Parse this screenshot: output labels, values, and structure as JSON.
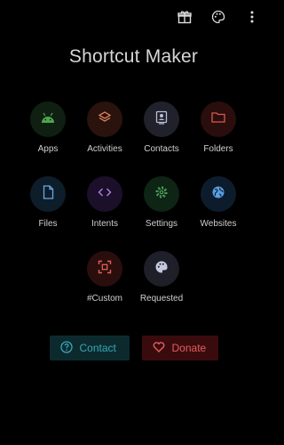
{
  "header": {
    "title": "Shortcut Maker",
    "icons": [
      "gift-icon",
      "palette-icon",
      "more-vert-icon"
    ]
  },
  "tiles": [
    {
      "label": "Apps",
      "icon": "android-icon",
      "bg": "#0f2012",
      "fg": "#4ea54f"
    },
    {
      "label": "Activities",
      "icon": "layers-icon",
      "bg": "#2a120d",
      "fg": "#e3875e"
    },
    {
      "label": "Contacts",
      "icon": "contact-icon",
      "bg": "#20212b",
      "fg": "#b9bdd8"
    },
    {
      "label": "Folders",
      "icon": "folder-icon",
      "bg": "#2a0d0d",
      "fg": "#d85a50"
    },
    {
      "label": "Files",
      "icon": "file-icon",
      "bg": "#0d1d2a",
      "fg": "#6aa8e8"
    },
    {
      "label": "Intents",
      "icon": "code-icon",
      "bg": "#1c0f2a",
      "fg": "#b07ee8"
    },
    {
      "label": "Settings",
      "icon": "gear-icon",
      "bg": "#0e2414",
      "fg": "#4fa45a"
    },
    {
      "label": "Websites",
      "icon": "globe-icon",
      "bg": "#0c1c2c",
      "fg": "#5a9de0"
    },
    {
      "label": "#Custom",
      "icon": "custom-frame-icon",
      "bg": "#2a0e0d",
      "fg": "#e06052"
    },
    {
      "label": "Requested",
      "icon": "palette-icon",
      "bg": "#1e1f28",
      "fg": "#c6c8e0"
    }
  ],
  "buttons": {
    "contact": "Contact",
    "donate": "Donate"
  }
}
